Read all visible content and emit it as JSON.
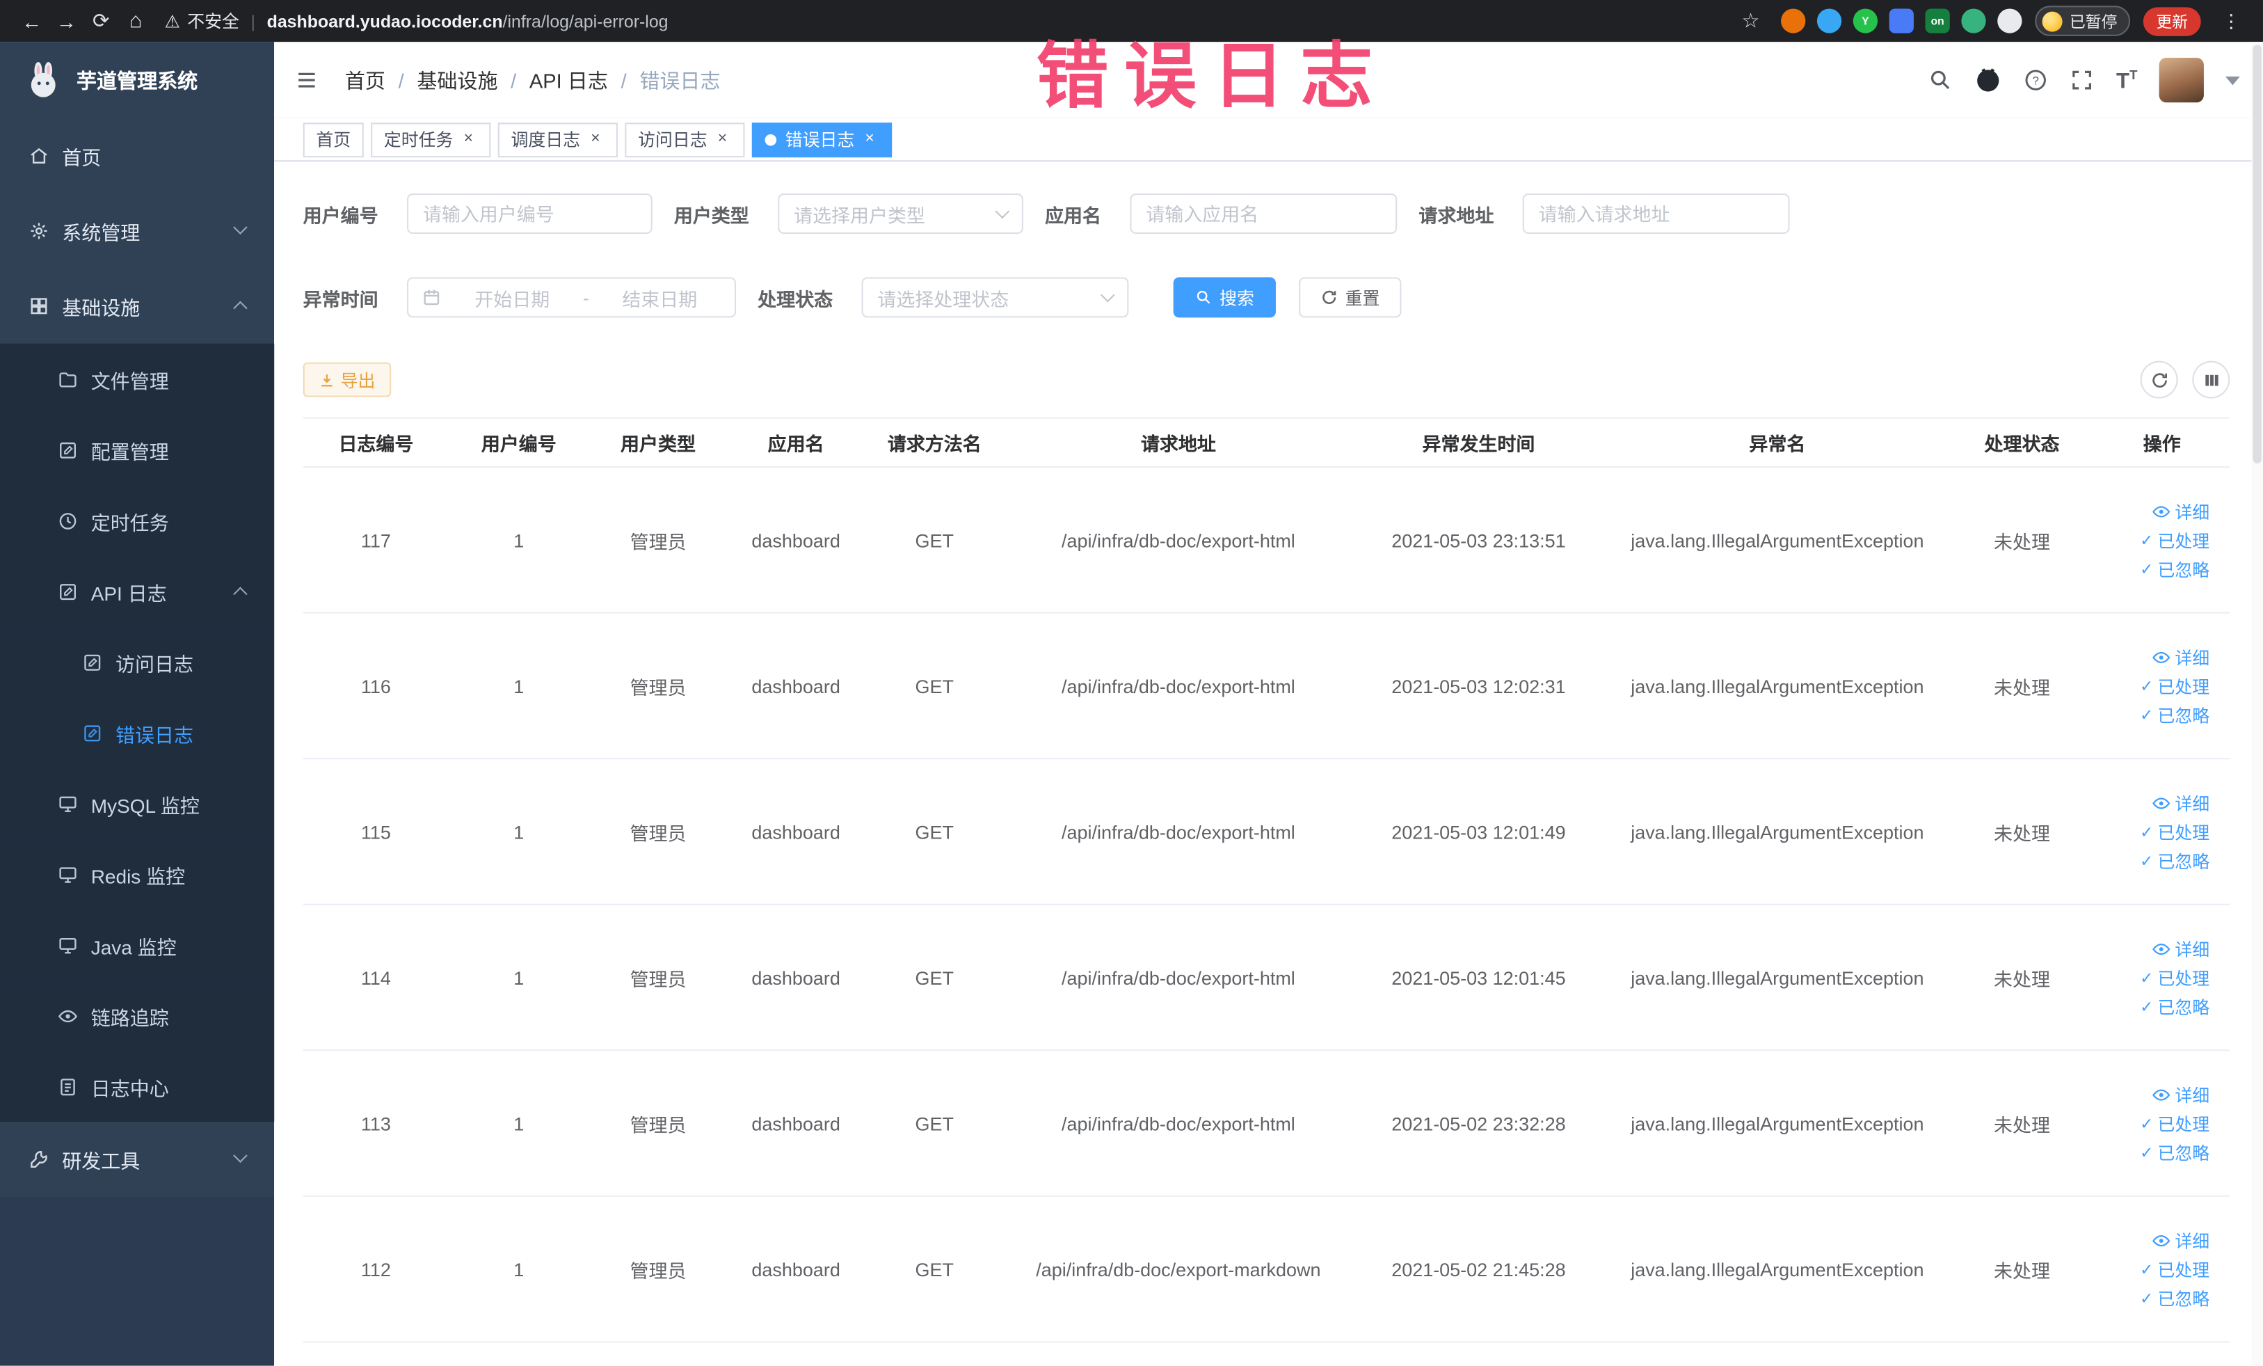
{
  "colors": {
    "accent": "#409eff",
    "warning": "#e6a23c",
    "annotation_pink": "#f23f6d",
    "sidebar_bg": "#304156",
    "submenu_bg": "#1f2d3d",
    "active_tab_bg": "#409eff"
  },
  "annotation": {
    "text": "错误日志"
  },
  "browser": {
    "security_label": "不安全",
    "url": {
      "domain": "dashboard.yudao.iocoder.cn",
      "path": "/infra/log/api-error-log"
    },
    "paused_label": "已暂停",
    "update_label": "更新",
    "extensions": [
      {
        "name": "extension-orange-icon",
        "color": "#e8710a",
        "shape": "circle",
        "letter": ""
      },
      {
        "name": "extension-blue-icon",
        "color": "#38a8f5",
        "shape": "circle",
        "letter": ""
      },
      {
        "name": "extension-green-y-icon",
        "color": "#27c24c",
        "shape": "circle",
        "letter": "Y"
      },
      {
        "name": "extension-blue-grid-icon",
        "color": "#4a7bf7",
        "shape": "square",
        "letter": ""
      },
      {
        "name": "extension-on-badge-icon",
        "color": "#15803d",
        "shape": "square",
        "letter": "on"
      },
      {
        "name": "extension-green-leaf-icon",
        "color": "#36b37e",
        "shape": "circle",
        "letter": ""
      },
      {
        "name": "extension-paw-icon",
        "color": "#e8eaed",
        "shape": "circle",
        "letter": ""
      }
    ]
  },
  "sidebar": {
    "logo_title": "芋道管理系统",
    "items": [
      {
        "label": "首页",
        "icon": "i-home",
        "level": 1
      },
      {
        "label": "系统管理",
        "icon": "i-gear",
        "level": 1,
        "arrow": "down"
      },
      {
        "label": "基础设施",
        "icon": "i-grid",
        "level": 1,
        "arrow": "up"
      },
      {
        "label": "文件管理",
        "icon": "i-folder",
        "level": 2
      },
      {
        "label": "配置管理",
        "icon": "i-edit",
        "level": 2
      },
      {
        "label": "定时任务",
        "icon": "i-clock",
        "level": 2
      },
      {
        "label": "API 日志",
        "icon": "i-edit",
        "level": 2,
        "arrow": "up"
      },
      {
        "label": "访问日志",
        "icon": "i-edit",
        "level": 3
      },
      {
        "label": "错误日志",
        "icon": "i-edit",
        "level": 3,
        "active": true
      },
      {
        "label": "MySQL 监控",
        "icon": "i-monitor",
        "level": 2
      },
      {
        "label": "Redis 监控",
        "icon": "i-monitor",
        "level": 2
      },
      {
        "label": "Java 监控",
        "icon": "i-monitor",
        "level": 2
      },
      {
        "label": "链路追踪",
        "icon": "i-eye",
        "level": 2
      },
      {
        "label": "日志中心",
        "icon": "i-doc",
        "level": 2
      },
      {
        "label": "研发工具",
        "icon": "i-tool",
        "level": 1,
        "arrow": "down"
      }
    ]
  },
  "header": {
    "breadcrumbs": [
      "首页",
      "基础设施",
      "API 日志",
      "错误日志"
    ]
  },
  "tabs": [
    {
      "label": "首页"
    },
    {
      "label": "定时任务",
      "closable": true
    },
    {
      "label": "调度日志",
      "closable": true
    },
    {
      "label": "访问日志",
      "closable": true
    },
    {
      "label": "错误日志",
      "closable": true,
      "active": true
    }
  ],
  "filters": {
    "user_id": {
      "label": "用户编号",
      "placeholder": "请输入用户编号"
    },
    "user_type": {
      "label": "用户类型",
      "placeholder": "请选择用户类型"
    },
    "app_name": {
      "label": "应用名",
      "placeholder": "请输入应用名"
    },
    "request_url": {
      "label": "请求地址",
      "placeholder": "请输入请求地址"
    },
    "exception_time": {
      "label": "异常时间",
      "start_placeholder": "开始日期",
      "separator": "-",
      "end_placeholder": "结束日期"
    },
    "process_status": {
      "label": "处理状态",
      "placeholder": "请选择处理状态"
    },
    "search_label": "搜索",
    "reset_label": "重置"
  },
  "toolbar": {
    "export_label": "导出"
  },
  "table": {
    "columns": [
      "日志编号",
      "用户编号",
      "用户类型",
      "应用名",
      "请求方法名",
      "请求地址",
      "异常发生时间",
      "异常名",
      "处理状态",
      "操作"
    ],
    "action_labels": [
      "详细",
      "已处理",
      "已忽略"
    ],
    "rows": [
      {
        "id": "117",
        "user_id": "1",
        "user_type": "管理员",
        "app": "dashboard",
        "method": "GET",
        "url": "/api/infra/db-doc/export-html",
        "time": "2021-05-03 23:13:51",
        "exception": "java.lang.IllegalArgumentException",
        "status": "未处理"
      },
      {
        "id": "116",
        "user_id": "1",
        "user_type": "管理员",
        "app": "dashboard",
        "method": "GET",
        "url": "/api/infra/db-doc/export-html",
        "time": "2021-05-03 12:02:31",
        "exception": "java.lang.IllegalArgumentException",
        "status": "未处理"
      },
      {
        "id": "115",
        "user_id": "1",
        "user_type": "管理员",
        "app": "dashboard",
        "method": "GET",
        "url": "/api/infra/db-doc/export-html",
        "time": "2021-05-03 12:01:49",
        "exception": "java.lang.IllegalArgumentException",
        "status": "未处理"
      },
      {
        "id": "114",
        "user_id": "1",
        "user_type": "管理员",
        "app": "dashboard",
        "method": "GET",
        "url": "/api/infra/db-doc/export-html",
        "time": "2021-05-03 12:01:45",
        "exception": "java.lang.IllegalArgumentException",
        "status": "未处理"
      },
      {
        "id": "113",
        "user_id": "1",
        "user_type": "管理员",
        "app": "dashboard",
        "method": "GET",
        "url": "/api/infra/db-doc/export-html",
        "time": "2021-05-02 23:32:28",
        "exception": "java.lang.IllegalArgumentException",
        "status": "未处理"
      },
      {
        "id": "112",
        "user_id": "1",
        "user_type": "管理员",
        "app": "dashboard",
        "method": "GET",
        "url": "/api/infra/db-doc/export-markdown",
        "time": "2021-05-02 21:45:28",
        "exception": "java.lang.IllegalArgumentException",
        "status": "未处理"
      }
    ]
  }
}
